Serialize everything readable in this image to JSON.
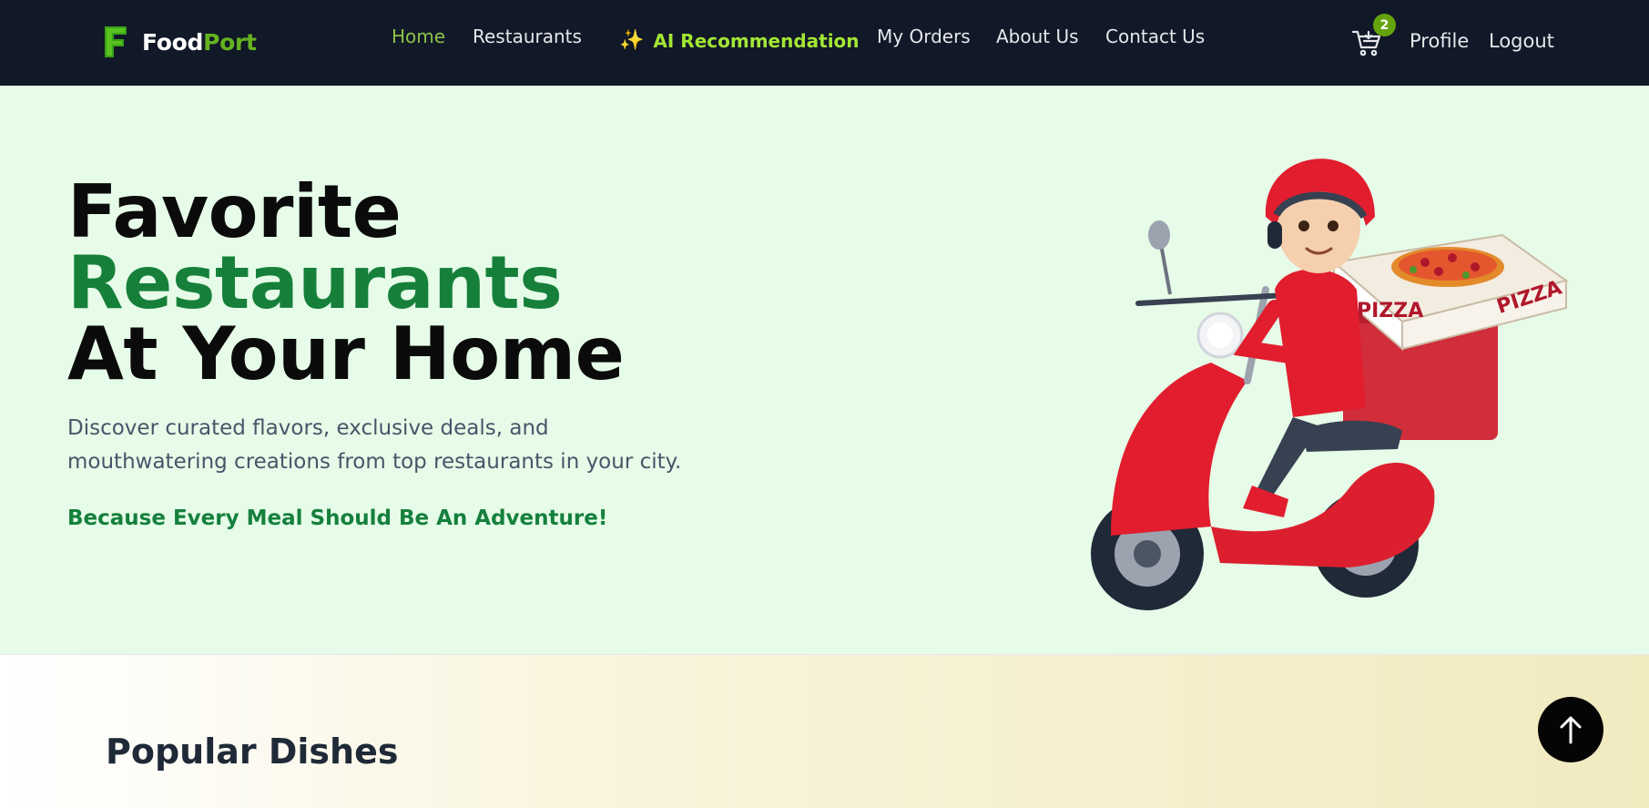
{
  "brand": {
    "name_part1": "Food",
    "name_part2": "Port",
    "accent_color": "#65b31f"
  },
  "nav": {
    "home": "Home",
    "restaurants": "Restaurants",
    "ai_icon": "✨",
    "ai_recommendation": "AI Recommendation",
    "my_orders": "My Orders",
    "about_us": "About Us",
    "contact_us": "Contact Us",
    "cart_icon": "cart-icon",
    "cart_count": "2",
    "profile": "Profile",
    "logout": "Logout"
  },
  "hero": {
    "title_line1": "Favorite",
    "title_line2": "Restaurants",
    "title_line3": "At Your Home",
    "description": "Discover curated flavors, exclusive deals, and mouthwatering creations from top restaurants in your city.",
    "tagline": "Because Every Meal Should Be An Adventure!",
    "illustration_box_text": "PIZZA"
  },
  "popular": {
    "title": "Popular Dishes"
  },
  "scroll_top": {
    "icon": "arrow-up-icon"
  },
  "colors": {
    "navbar": "#111827",
    "hero_bg": "#e6fce8",
    "green": "#16803a",
    "active_link": "#8bc34a"
  }
}
